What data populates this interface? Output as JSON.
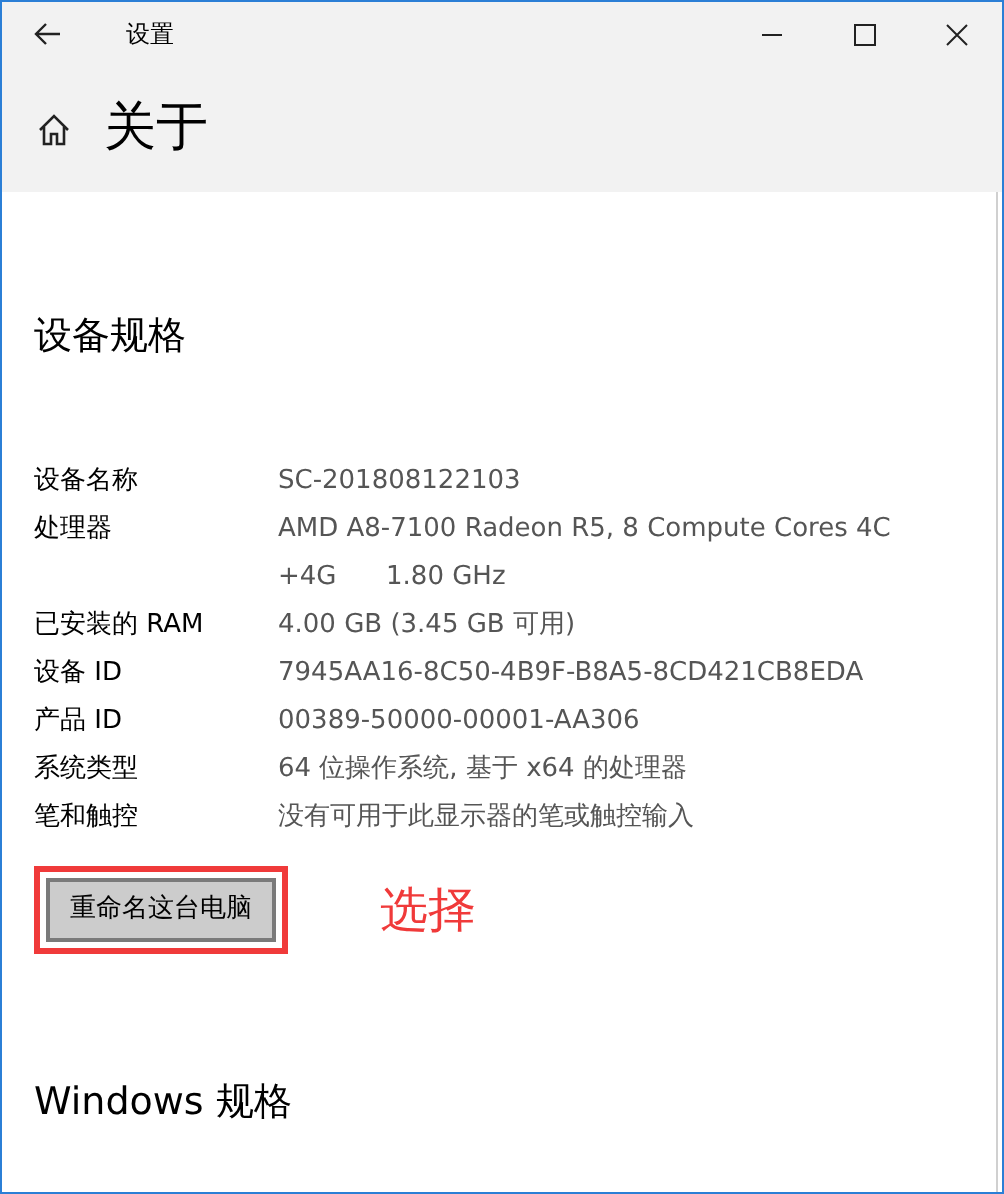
{
  "window": {
    "title": "设置"
  },
  "page": {
    "title": "关于"
  },
  "section": {
    "title": "设备规格"
  },
  "specs": [
    {
      "label": "设备名称",
      "lines": [
        "SC-201808122103"
      ]
    },
    {
      "label": "处理器",
      "lines": [
        "AMD A8-7100 Radeon R5, 8 Compute Cores 4C",
        "+4G      1.80 GHz"
      ]
    },
    {
      "label": "已安装的 RAM",
      "lines": [
        "4.00 GB (3.45 GB 可用)"
      ]
    },
    {
      "label": "设备 ID",
      "lines": [
        "7945AA16-8C50-4B9F-B8A5-8CD421CB8EDA"
      ]
    },
    {
      "label": "产品 ID",
      "lines": [
        "00389-50000-00001-AA306"
      ]
    },
    {
      "label": "系统类型",
      "lines": [
        "64 位操作系统, 基于 x64 的处理器"
      ]
    },
    {
      "label": "笔和触控",
      "lines": [
        "没有可用于此显示器的笔或触控输入"
      ]
    }
  ],
  "rename_button": {
    "label": "重命名这台电脑"
  },
  "annotation": {
    "text": "选择"
  },
  "next_section": {
    "title": "Windows 规格"
  }
}
